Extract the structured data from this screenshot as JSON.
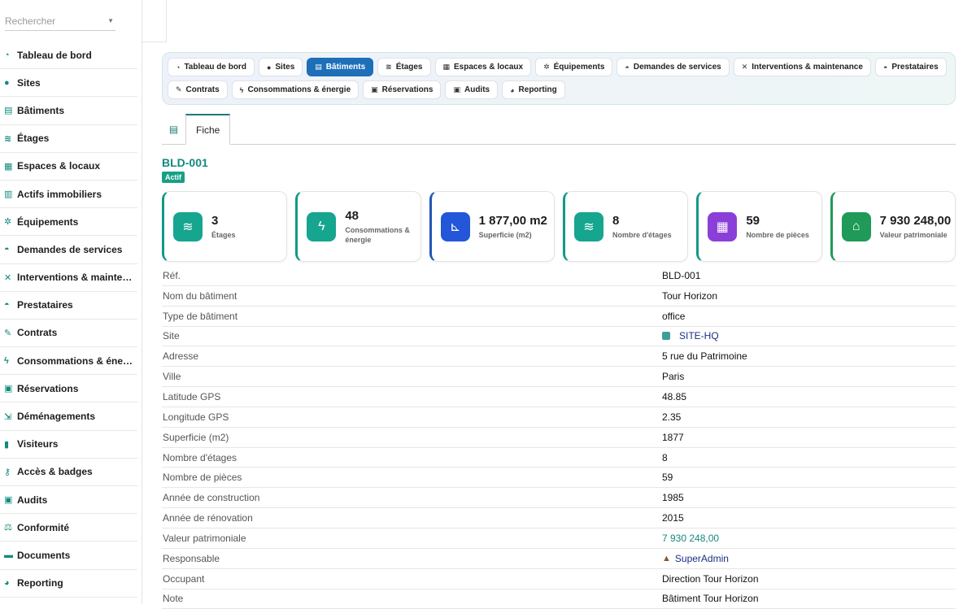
{
  "search": {
    "placeholder": "Rechercher"
  },
  "sidebar": {
    "items": [
      {
        "icon": "gauge-icon",
        "glyph": "◔",
        "label": "Tableau de bord"
      },
      {
        "icon": "map-pin-icon",
        "glyph": "●",
        "label": "Sites"
      },
      {
        "icon": "building-icon",
        "glyph": "▤",
        "label": "Bâtiments"
      },
      {
        "icon": "layers-icon",
        "glyph": "≋",
        "label": "Étages"
      },
      {
        "icon": "grid-icon",
        "glyph": "▦",
        "label": "Espaces & locaux"
      },
      {
        "icon": "property-icon",
        "glyph": "▥",
        "label": "Actifs immobiliers"
      },
      {
        "icon": "gears-icon",
        "glyph": "✲",
        "label": "Équipements"
      },
      {
        "icon": "service-bell-icon",
        "glyph": "◓",
        "label": "Demandes de services"
      },
      {
        "icon": "tools-icon",
        "glyph": "✕",
        "label": "Interventions & maintenance"
      },
      {
        "icon": "contractor-icon",
        "glyph": "◓",
        "label": "Prestataires"
      },
      {
        "icon": "contract-icon",
        "glyph": "✎",
        "label": "Contrats"
      },
      {
        "icon": "bolt-icon",
        "glyph": "ϟ",
        "label": "Consommations & énergie"
      },
      {
        "icon": "calendar-check-icon",
        "glyph": "▣",
        "label": "Réservations"
      },
      {
        "icon": "dolly-icon",
        "glyph": "⇲",
        "label": "Déménagements"
      },
      {
        "icon": "id-badge-icon",
        "glyph": "▮",
        "label": "Visiteurs"
      },
      {
        "icon": "key-icon",
        "glyph": "⚷",
        "label": "Accès & badges"
      },
      {
        "icon": "clipboard-check-icon",
        "glyph": "▣",
        "label": "Audits"
      },
      {
        "icon": "scale-icon",
        "glyph": "⚖",
        "label": "Conformité"
      },
      {
        "icon": "folder-icon",
        "glyph": "▬",
        "label": "Documents"
      },
      {
        "icon": "pie-chart-icon",
        "glyph": "◕",
        "label": "Reporting"
      }
    ]
  },
  "nav": {
    "row1": [
      {
        "icon": "gauge-icon",
        "glyph": "◔",
        "label": "Tableau de bord",
        "active": false
      },
      {
        "icon": "map-pin-icon",
        "glyph": "●",
        "label": "Sites",
        "active": false
      },
      {
        "icon": "building-icon",
        "glyph": "▤",
        "label": "Bâtiments",
        "active": true
      },
      {
        "icon": "layers-icon",
        "glyph": "≋",
        "label": "Étages",
        "active": false
      },
      {
        "icon": "grid-icon",
        "glyph": "▦",
        "label": "Espaces & locaux",
        "active": false
      },
      {
        "icon": "gears-icon",
        "glyph": "✲",
        "label": "Équipements",
        "active": false
      },
      {
        "icon": "service-bell-icon",
        "glyph": "◓",
        "label": "Demandes de services",
        "active": false
      },
      {
        "icon": "tools-icon",
        "glyph": "✕",
        "label": "Interventions & maintenance",
        "active": false
      },
      {
        "icon": "contractor-icon",
        "glyph": "◓",
        "label": "Prestataires",
        "active": false
      }
    ],
    "row2": [
      {
        "icon": "contract-icon",
        "glyph": "✎",
        "label": "Contrats",
        "active": false
      },
      {
        "icon": "bolt-icon",
        "glyph": "ϟ",
        "label": "Consommations & énergie",
        "active": false
      },
      {
        "icon": "calendar-check-icon",
        "glyph": "▣",
        "label": "Réservations",
        "active": false
      },
      {
        "icon": "clipboard-check-icon",
        "glyph": "▣",
        "label": "Audits",
        "active": false
      },
      {
        "icon": "pie-chart-icon",
        "glyph": "◕",
        "label": "Reporting",
        "active": false
      }
    ]
  },
  "tabs": {
    "fiche": "Fiche"
  },
  "record": {
    "ref": "BLD-001",
    "status": "Actif"
  },
  "colors": {
    "teal": "#12998a",
    "blue": "#2356b8",
    "purple": "#8b3fd9",
    "green": "#1f9a58",
    "active_nav": "#1d6fb8"
  },
  "cards": [
    {
      "icon": "layers-icon",
      "glyph": "≋",
      "color": "#16a58f",
      "variant": "",
      "value": "3",
      "label": "Étages"
    },
    {
      "icon": "bolt-icon",
      "glyph": "ϟ",
      "color": "#16a58f",
      "variant": "",
      "value": "48",
      "label": "Consommations & énergie"
    },
    {
      "icon": "ruler-icon",
      "glyph": "⊾",
      "color": "#2356d8",
      "variant": "blue",
      "value": "1 877,00 m2",
      "label": "Superficie (m2)"
    },
    {
      "icon": "layers-icon",
      "glyph": "≋",
      "color": "#16a58f",
      "variant": "",
      "value": "8",
      "label": "Nombre d'étages"
    },
    {
      "icon": "grid-icon",
      "glyph": "▦",
      "color": "#8b3fd9",
      "variant": "",
      "value": "59",
      "label": "Nombre de pièces"
    },
    {
      "icon": "bank-icon",
      "glyph": "⌂",
      "color": "#1f9a58",
      "variant": "green",
      "value": "7 930 248,00",
      "label": "Valeur patrimoniale"
    }
  ],
  "properties": [
    {
      "label": "Réf.",
      "value": "BLD-001",
      "style": ""
    },
    {
      "label": "Nom du bâtiment",
      "value": "Tour Horizon",
      "style": ""
    },
    {
      "label": "Type de bâtiment",
      "value": "office",
      "style": ""
    },
    {
      "label": "Site",
      "value": "SITE-HQ",
      "style": "link",
      "icon": "site-icon"
    },
    {
      "label": "Adresse",
      "value": "5 rue du Patrimoine",
      "style": ""
    },
    {
      "label": "Ville",
      "value": "Paris",
      "style": ""
    },
    {
      "label": "Latitude GPS",
      "value": "48.85",
      "style": ""
    },
    {
      "label": "Longitude GPS",
      "value": "2.35",
      "style": ""
    },
    {
      "label": "Superficie (m2)",
      "value": "1877",
      "style": ""
    },
    {
      "label": "Nombre d'étages",
      "value": "8",
      "style": ""
    },
    {
      "label": "Nombre de pièces",
      "value": "59",
      "style": ""
    },
    {
      "label": "Année de construction",
      "value": "1985",
      "style": ""
    },
    {
      "label": "Année de rénovation",
      "value": "2015",
      "style": ""
    },
    {
      "label": "Valeur patrimoniale",
      "value": "7 930 248,00",
      "style": "teal"
    },
    {
      "label": "Responsable",
      "value": "SuperAdmin",
      "style": "link",
      "icon": "user-icon"
    },
    {
      "label": "Occupant",
      "value": "Direction Tour Horizon",
      "style": ""
    },
    {
      "label": "Note",
      "value": "Bâtiment Tour Horizon",
      "style": ""
    }
  ]
}
